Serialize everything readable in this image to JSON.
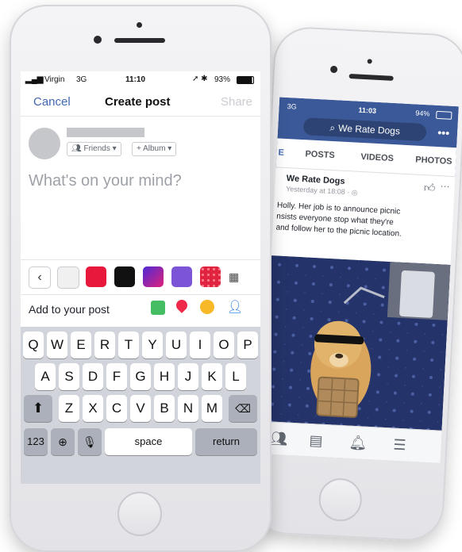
{
  "front": {
    "status": {
      "carrier": "Virgin",
      "network": "3G",
      "time": "11:10",
      "battery": "93%"
    },
    "nav": {
      "cancel": "Cancel",
      "title": "Create post",
      "share": "Share"
    },
    "composer": {
      "audience": "Friends",
      "album": "+ Album",
      "placeholder": "What's on your mind?"
    },
    "add_to_post": "Add to your post",
    "keyboard": {
      "row1": [
        "Q",
        "W",
        "E",
        "R",
        "T",
        "Y",
        "U",
        "I",
        "O",
        "P"
      ],
      "row2": [
        "A",
        "S",
        "D",
        "F",
        "G",
        "H",
        "J",
        "K",
        "L"
      ],
      "row3": [
        "Z",
        "X",
        "C",
        "V",
        "B",
        "N",
        "M"
      ],
      "numbers": "123",
      "space": "space",
      "return": "return"
    },
    "colors": {
      "swatch_red": "#e8173c",
      "swatch_black": "#111111",
      "swatch_violet": "#7b55d6",
      "link": "#4267b2"
    }
  },
  "back": {
    "status": {
      "network": "3G",
      "time": "11:03",
      "battery": "94%"
    },
    "search": "We Rate Dogs",
    "tabs": [
      "POSTS",
      "VIDEOS",
      "PHOTOS"
    ],
    "post": {
      "page": "We Rate Dogs",
      "meta": "Yesterday at 18:08 ·",
      "line1": "Holly. Her job is to announce picnic",
      "line2": "nsists everyone stop what they're",
      "line3": "and follow her to the picnic location."
    },
    "colors": {
      "facebook_blue": "#3b5998"
    }
  }
}
